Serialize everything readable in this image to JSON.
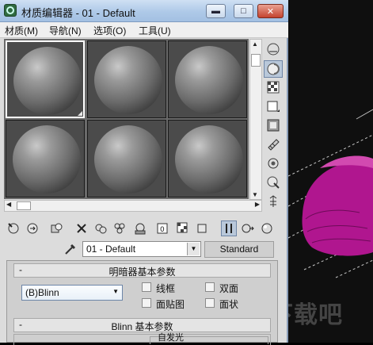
{
  "window": {
    "title": "材质编辑器 - 01 - Default",
    "minimize_glyph": "▬",
    "maximize_glyph": "□",
    "close_glyph": "✕"
  },
  "menu": {
    "items": [
      "材质(M)",
      "导航(N)",
      "选项(O)",
      "工具(U)"
    ]
  },
  "material_slots": {
    "rows": 2,
    "columns": 3,
    "active_index": 0
  },
  "material": {
    "name": "01 - Default",
    "type": "Standard"
  },
  "shader_rollout": {
    "title": "明暗器基本参数",
    "shader": "(B)Blinn",
    "options": [
      "线框",
      "双面",
      "面贴图",
      "面状"
    ]
  },
  "blinn_rollout": {
    "title": "Blinn 基本参数",
    "self_illum_label": "自发光"
  },
  "watermark": "下载吧",
  "colors": {
    "teapot": "#b0168f",
    "grid": "#c8c8c8",
    "title_bar": "#aec9e8"
  },
  "icons": {
    "side_tools": [
      "sample-type-icon",
      "backlight-icon",
      "background-icon",
      "uv-tiling-icon",
      "video-color-check-icon",
      "make-preview-icon",
      "options-icon",
      "select-by-material-icon",
      "material-navigator-icon"
    ],
    "bottom_tools": [
      "get-material-icon",
      "put-to-scene-icon",
      "assign-to-selection-icon",
      "reset-map-icon",
      "copy-material-icon",
      "make-unique-icon",
      "put-to-library-icon",
      "material-id-channel-icon",
      "show-map-in-viewport-icon",
      "show-end-result-icon",
      "go-to-parent-icon",
      "go-forward-to-sibling-icon"
    ]
  }
}
